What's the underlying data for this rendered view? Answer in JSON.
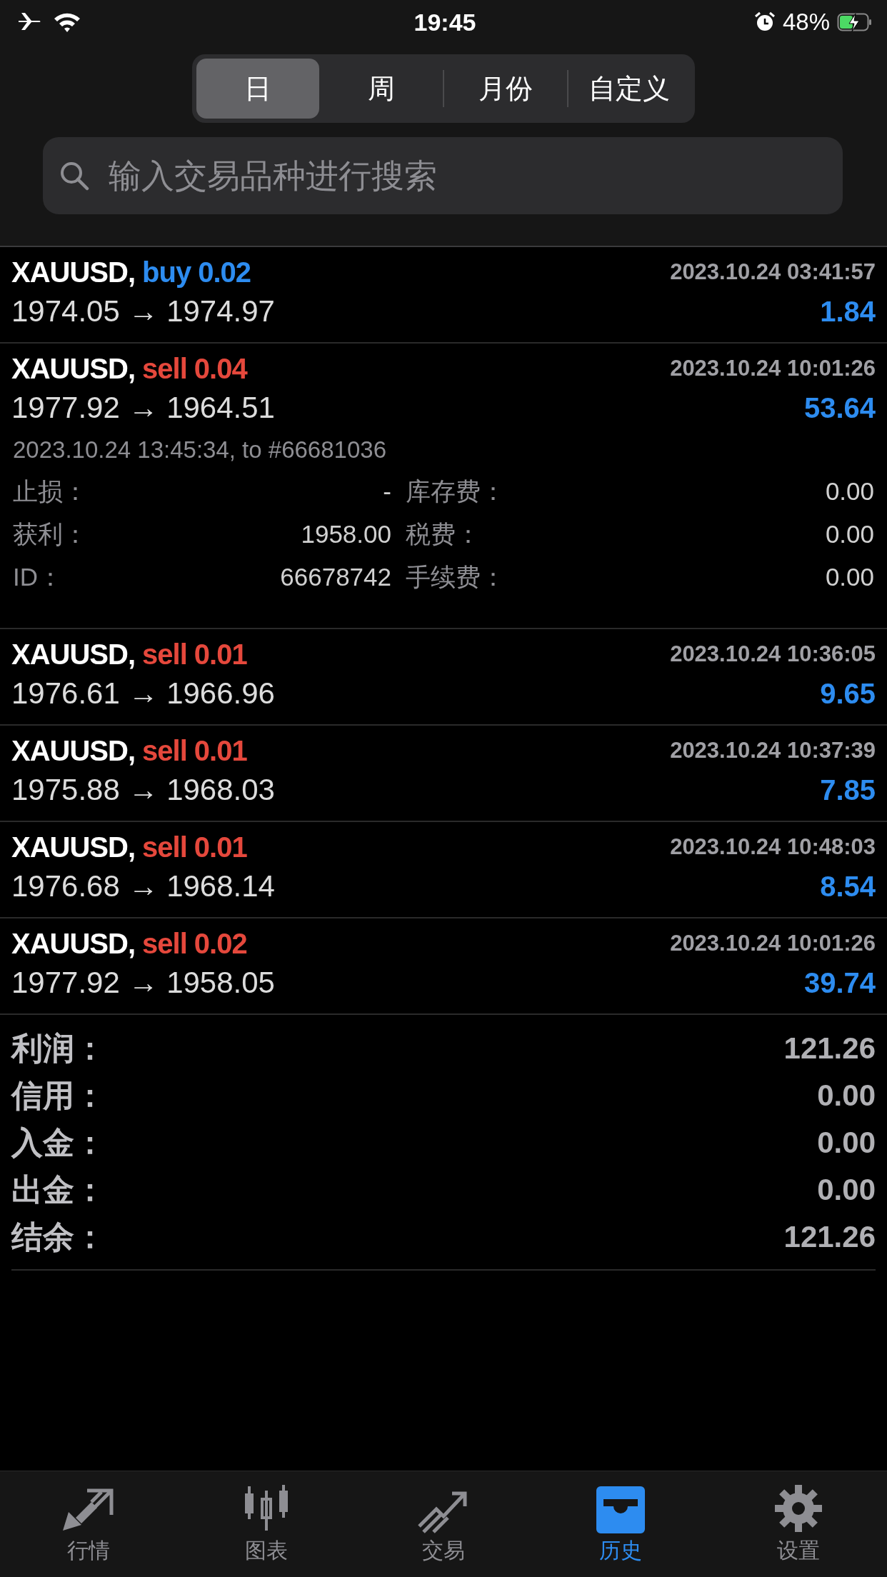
{
  "status_bar": {
    "time": "19:45",
    "battery": "48%",
    "charging": true
  },
  "period_tabs": [
    {
      "label": "日",
      "selected": true
    },
    {
      "label": "周",
      "selected": false
    },
    {
      "label": "月份",
      "selected": false
    },
    {
      "label": "自定义",
      "selected": false
    }
  ],
  "search": {
    "placeholder": "输入交易品种进行搜索"
  },
  "trades": [
    {
      "symbol": "XAUUSD,",
      "kind": "buy",
      "order": "buy 0.02",
      "time": "2023.10.24 03:41:57",
      "prices": "1974.05 → 1974.97",
      "profit": "1.84",
      "expanded": false
    },
    {
      "symbol": "XAUUSD,",
      "kind": "sell",
      "order": "sell 0.04",
      "time": "2023.10.24 10:01:26",
      "prices": "1977.92 → 1964.51",
      "profit": "53.64",
      "expanded": true,
      "close_info": "2023.10.24 13:45:34, to #66681036",
      "fields_left": [
        {
          "label": "止损：",
          "value": "-"
        },
        {
          "label": "获利：",
          "value": "1958.00"
        },
        {
          "label": "ID：",
          "value": "66678742"
        }
      ],
      "fields_right": [
        {
          "label": "库存费：",
          "value": "0.00"
        },
        {
          "label": "税费：",
          "value": "0.00"
        },
        {
          "label": "手续费：",
          "value": "0.00"
        }
      ]
    },
    {
      "symbol": "XAUUSD,",
      "kind": "sell",
      "order": "sell 0.01",
      "time": "2023.10.24 10:36:05",
      "prices": "1976.61 → 1966.96",
      "profit": "9.65",
      "expanded": false
    },
    {
      "symbol": "XAUUSD,",
      "kind": "sell",
      "order": "sell 0.01",
      "time": "2023.10.24 10:37:39",
      "prices": "1975.88 → 1968.03",
      "profit": "7.85",
      "expanded": false
    },
    {
      "symbol": "XAUUSD,",
      "kind": "sell",
      "order": "sell 0.01",
      "time": "2023.10.24 10:48:03",
      "prices": "1976.68 → 1968.14",
      "profit": "8.54",
      "expanded": false
    },
    {
      "symbol": "XAUUSD,",
      "kind": "sell",
      "order": "sell 0.02",
      "time": "2023.10.24 10:01:26",
      "prices": "1977.92 → 1958.05",
      "profit": "39.74",
      "expanded": false
    }
  ],
  "summary": [
    {
      "label": "利润：",
      "value": "121.26"
    },
    {
      "label": "信用：",
      "value": "0.00"
    },
    {
      "label": "入金：",
      "value": "0.00"
    },
    {
      "label": "出金：",
      "value": "0.00"
    },
    {
      "label": "结余：",
      "value": "121.26"
    }
  ],
  "tab_bar": [
    {
      "label": "行情",
      "selected": false
    },
    {
      "label": "图表",
      "selected": false
    },
    {
      "label": "交易",
      "selected": false
    },
    {
      "label": "历史",
      "selected": true
    },
    {
      "label": "设置",
      "selected": false
    }
  ]
}
